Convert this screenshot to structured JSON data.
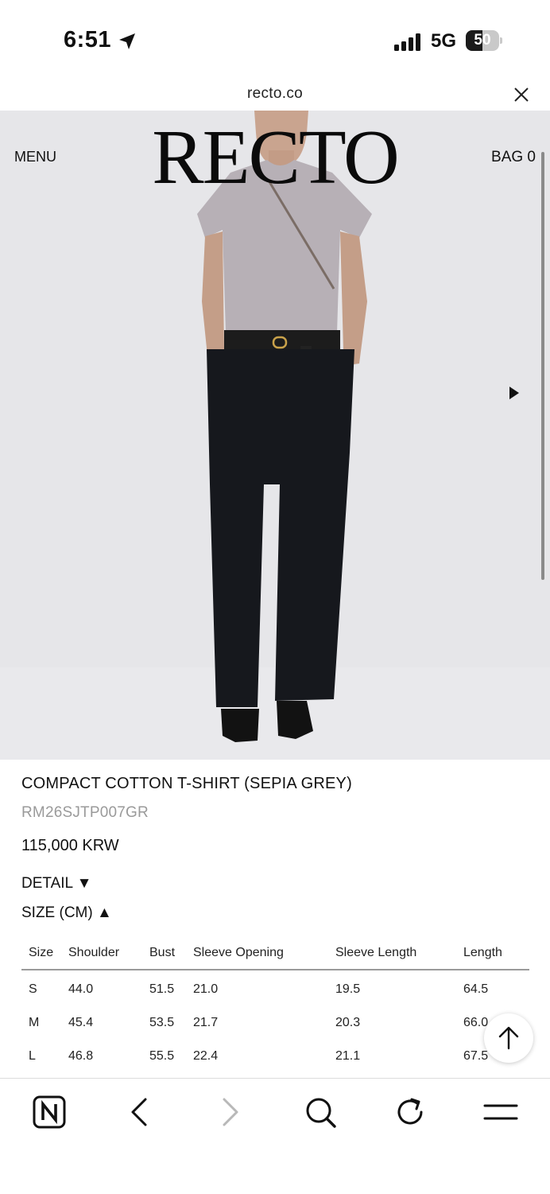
{
  "status_bar": {
    "time": "6:51",
    "network": "5G",
    "battery_level": "50",
    "battery_fraction": 0.5
  },
  "browser": {
    "url": "recto.co"
  },
  "site": {
    "logo": "RECTO",
    "menu_label": "MENU",
    "bag_label": "BAG 0"
  },
  "product": {
    "title": "COMPACT COTTON T-SHIRT (SEPIA GREY)",
    "sku": "RM26SJTP007GR",
    "price": "115,000 KRW",
    "detail_toggle": "DETAIL ▼",
    "size_toggle": "SIZE (CM) ▲"
  },
  "size_table": {
    "headers": [
      "Size",
      "Shoulder",
      "Bust",
      "Sleeve Opening",
      "Sleeve Length",
      "Length"
    ],
    "rows": [
      [
        "S",
        "44.0",
        "51.5",
        "21.0",
        "19.5",
        "64.5"
      ],
      [
        "M",
        "45.4",
        "53.5",
        "21.7",
        "20.3",
        "66.0"
      ],
      [
        "L",
        "46.8",
        "55.5",
        "22.4",
        "21.1",
        "67.5"
      ]
    ]
  },
  "colors": {
    "hero_background": "#e6e6e9",
    "text": "#111111",
    "sku_grey": "#9a9a9a"
  },
  "icons": {
    "status": [
      "location-arrow-icon",
      "signal-bars-icon",
      "battery-icon"
    ],
    "browser": [
      "close-icon"
    ],
    "toolbar": [
      "naver-logo-icon",
      "back-icon",
      "forward-icon",
      "search-icon",
      "reload-icon",
      "menu-icon"
    ],
    "floating": [
      "scroll-to-top-icon"
    ],
    "carousel": [
      "next-image-icon"
    ]
  }
}
